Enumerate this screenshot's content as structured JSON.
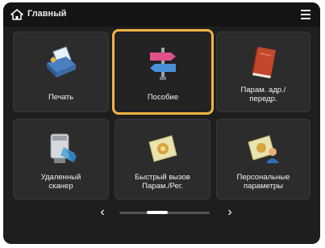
{
  "header": {
    "title": "Главный"
  },
  "tiles": [
    {
      "label": "Печать"
    },
    {
      "label": "Пособие"
    },
    {
      "label": "Парам. адр./\nпередр."
    },
    {
      "label": "Удаленный\nсканер"
    },
    {
      "label": "Быстрый вызов\nПарам./Рег."
    },
    {
      "label": "Персональные\nпараметры"
    }
  ],
  "pager": {
    "prev": "‹",
    "next": "›"
  },
  "colors": {
    "selection": "#f0b341",
    "background": "#1e1e1e"
  }
}
